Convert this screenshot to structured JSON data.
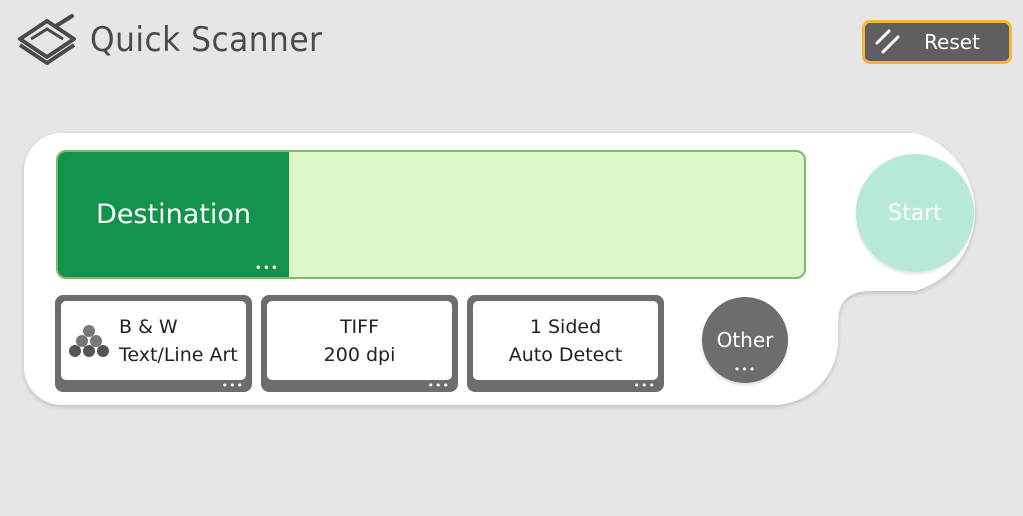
{
  "header": {
    "title": "Quick Scanner",
    "icon": "scanner-icon"
  },
  "reset": {
    "label": "Reset",
    "icon": "reset-icon",
    "border_color": "#f2b632"
  },
  "destination": {
    "label": "Destination",
    "value": "",
    "more": "•••"
  },
  "start": {
    "label": "Start"
  },
  "options": {
    "color_mode": {
      "line1": "B & W",
      "line2": "Text/Line Art",
      "icon": "bw-dots-icon",
      "more": "•••"
    },
    "file_format": {
      "line1": "TIFF",
      "line2": "200 dpi",
      "more": "•••"
    },
    "sides": {
      "line1": "1 Sided",
      "line2": "Auto Detect",
      "more": "•••"
    },
    "other": {
      "label": "Other",
      "more": "•••"
    }
  },
  "colors": {
    "destination_green": "#13924b",
    "destination_field": "#dcf8c8",
    "start_disabled": "#b7e8d9",
    "option_frame": "#6d6d6d",
    "background": "#e6e6e6"
  }
}
